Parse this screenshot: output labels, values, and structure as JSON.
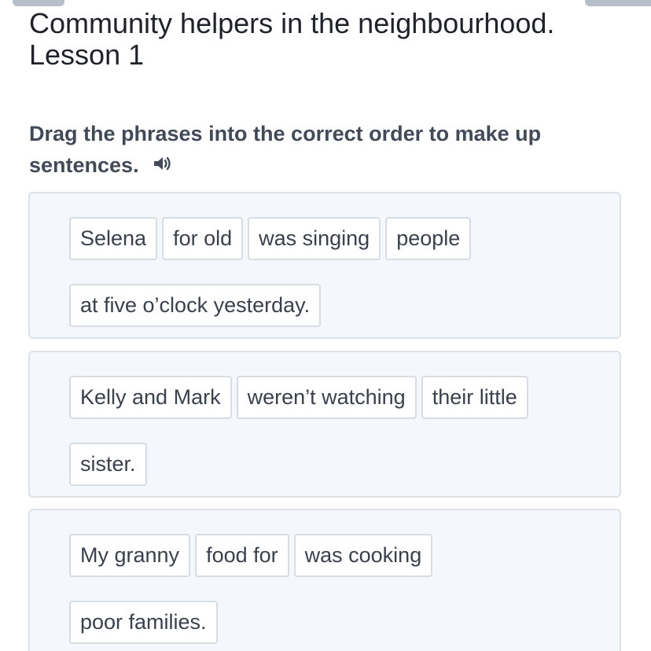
{
  "lesson": {
    "title_line1": "Community helpers in the neighbourhood.",
    "title_line2": "Lesson 1"
  },
  "task": {
    "instruction_line1": "Drag the phrases into the correct order to make up",
    "instruction_line2": "sentences."
  },
  "icons": {
    "speaker": "speaker-icon"
  },
  "colors": {
    "box_background": "#f4f7fb",
    "box_border": "#dde2e9",
    "chip_border": "#d8dde4",
    "instruction_text": "#434a57"
  },
  "sentences": [
    {
      "row1": [
        "Selena",
        "for old",
        "was singing",
        "people"
      ],
      "row2": [
        "at five o’clock yesterday."
      ]
    },
    {
      "row1": [
        "Kelly and Mark",
        "weren’t watching",
        "their little"
      ],
      "row2": [
        "sister."
      ]
    },
    {
      "row1": [
        "My granny",
        "food for",
        "was cooking"
      ],
      "row2": [
        "poor families."
      ]
    }
  ]
}
